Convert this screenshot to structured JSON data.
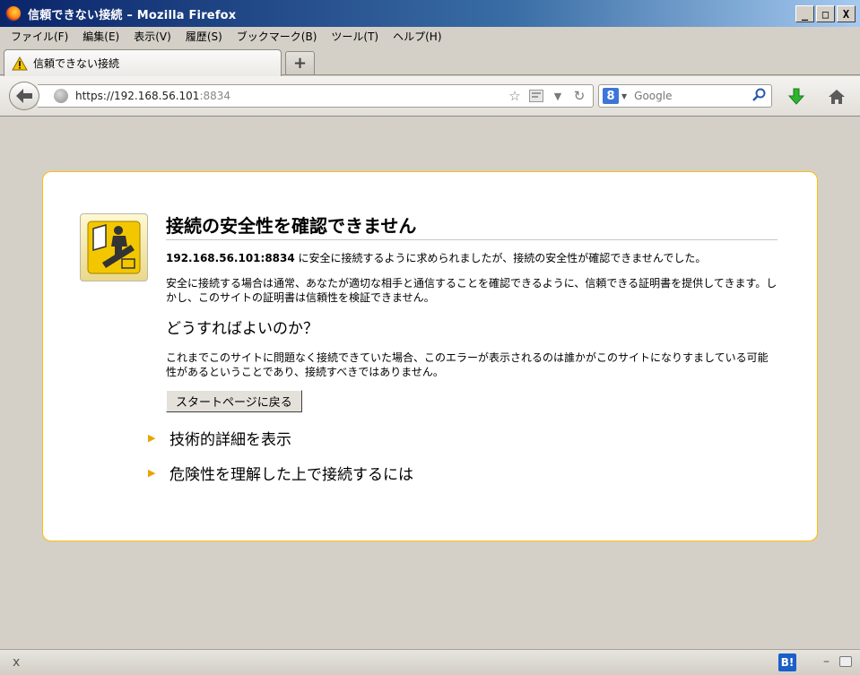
{
  "window": {
    "title": "信頼できない接続 – Mozilla Firefox",
    "minimize": "_",
    "maximize": "□",
    "close": "X"
  },
  "menu": [
    "ファイル(F)",
    "編集(E)",
    "表示(V)",
    "履歴(S)",
    "ブックマーク(B)",
    "ツール(T)",
    "ヘルプ(H)"
  ],
  "tab": {
    "label": "信頼できない接続",
    "new_tab": "+"
  },
  "url": {
    "host": "https://192.168.56.101",
    "port": ":8834"
  },
  "search": {
    "engine_letter": "8",
    "placeholder": "Google"
  },
  "error": {
    "title": "接続の安全性を確認できません",
    "host": "192.168.56.101:8834",
    "p1": " に安全に接続するように求められましたが、接続の安全性が確認できませんでした。",
    "p2": "安全に接続する場合は通常、あなたが適切な相手と通信することを確認できるように、信頼できる証明書を提供してきます。しかし、このサイトの証明書は信頼性を検証できません。",
    "h2": "どうすればよいのか？",
    "p3": "これまでこのサイトに問題なく接続できていた場合、このエラーが表示されるのは誰かがこのサイトになりすましている可能性があるということであり、接続すべきではありません。",
    "button": "スタートページに戻る",
    "expander1": "技術的詳細を表示",
    "expander2": "危険性を理解した上で接続するには"
  },
  "status": {
    "close": "x",
    "hatena": "B!",
    "dash": "–"
  },
  "colors": {
    "titlebar_start": "#0a246a",
    "box_border": "#ffbd09",
    "expander_arrow": "#e8a400"
  }
}
